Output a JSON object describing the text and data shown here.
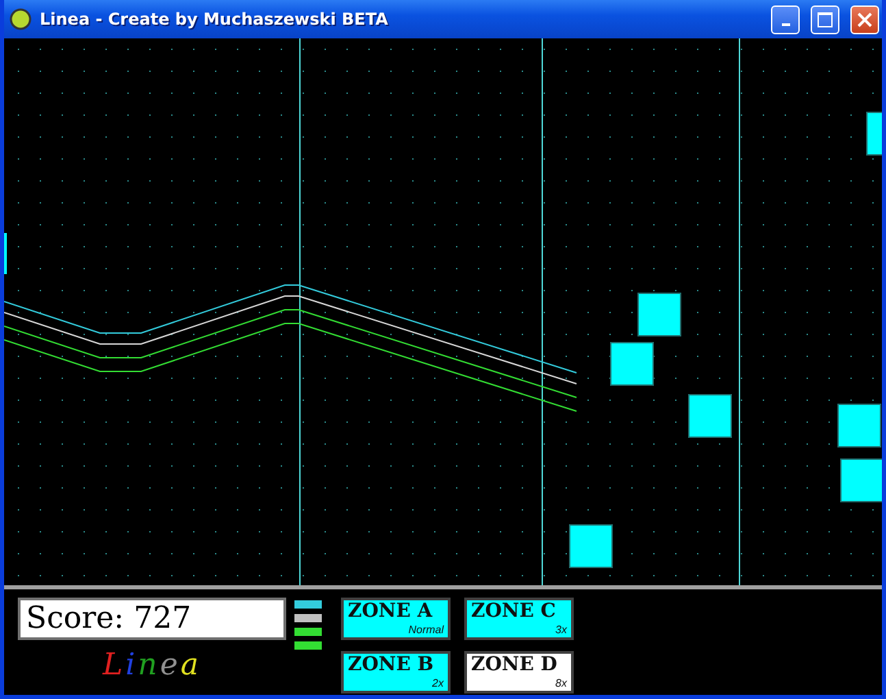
{
  "window": {
    "title": "Linea - Create by Muchaszewski BETA"
  },
  "game": {
    "lines": [
      {
        "color": "#33ccdd"
      },
      {
        "color": "#d8d8d8"
      },
      {
        "color": "#33dd33"
      },
      {
        "color": "#33dd33"
      }
    ]
  },
  "score": {
    "text": "Score: 727"
  },
  "logo": {
    "letters": [
      {
        "char": "L",
        "color": "#e02020"
      },
      {
        "char": "i",
        "color": "#2040e0"
      },
      {
        "char": "n",
        "color": "#20a020"
      },
      {
        "char": "e",
        "color": "#909090"
      },
      {
        "char": "a",
        "color": "#e0e020"
      }
    ]
  },
  "lives": [
    {
      "color": "#33ccdd"
    },
    {
      "color": "#c0c0c0"
    },
    {
      "color": "#33dd33"
    },
    {
      "color": "#33dd33"
    }
  ],
  "zones": [
    {
      "label": "ZONE A",
      "multiplier": "Normal",
      "selected": false
    },
    {
      "label": "ZONE C",
      "multiplier": "3x",
      "selected": false
    },
    {
      "label": "ZONE B",
      "multiplier": "2x",
      "selected": false
    },
    {
      "label": "ZONE D",
      "multiplier": "8x",
      "selected": true
    }
  ]
}
